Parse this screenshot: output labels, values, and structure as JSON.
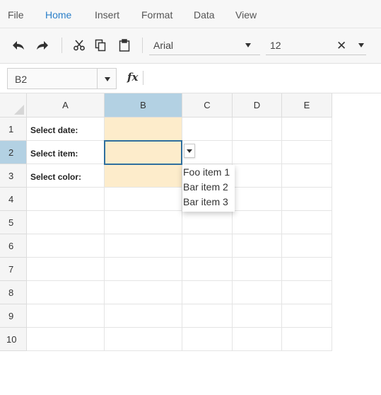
{
  "menu": {
    "items": [
      "File",
      "Home",
      "Insert",
      "Format",
      "Data",
      "View"
    ],
    "active": "Home"
  },
  "toolbar": {
    "icons": [
      "undo-icon",
      "redo-icon",
      "cut-icon",
      "copy-icon",
      "paste-icon",
      "clear-format-icon"
    ],
    "font_family": "Arial",
    "font_size": "12"
  },
  "formula_bar": {
    "name_box": "B2",
    "fx_label": "fx",
    "formula": ""
  },
  "sheet": {
    "columns": [
      "A",
      "B",
      "C",
      "D",
      "E"
    ],
    "rows": [
      "1",
      "2",
      "3",
      "4",
      "5",
      "6",
      "7",
      "8",
      "9",
      "10"
    ],
    "selected_cell": "B2",
    "cells": {
      "A1": "Select date:",
      "A2": "Select item:",
      "A3": "Select color:"
    },
    "input_fill_color": "#fdeccb",
    "selection_color": "#b3d1e3"
  },
  "dropdown": {
    "options": [
      "Foo item 1",
      "Bar item 2",
      "Bar item 3"
    ]
  }
}
